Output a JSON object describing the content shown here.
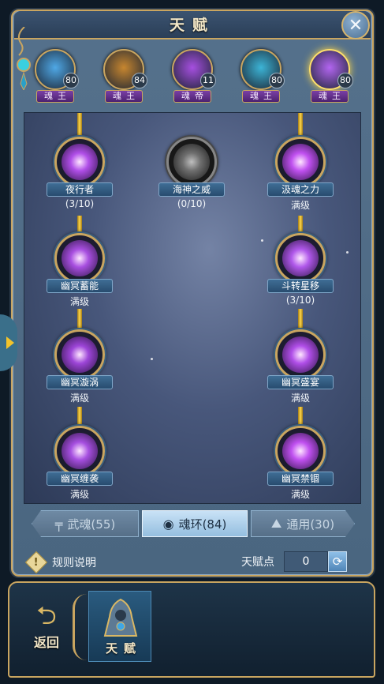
{
  "header": {
    "title": "天赋"
  },
  "spirits": [
    {
      "level": "80",
      "rank": "魂王",
      "color": "#4fa8e6",
      "selected": false
    },
    {
      "level": "84",
      "rank": "魂王",
      "color": "#c7862f",
      "selected": false
    },
    {
      "level": "11",
      "rank": "魂帝",
      "color": "#a64fe0",
      "selected": false
    },
    {
      "level": "80",
      "rank": "魂王",
      "color": "#3cb4d6",
      "selected": false
    },
    {
      "level": "80",
      "rank": "魂王",
      "color": "#b265f0",
      "selected": true
    }
  ],
  "talents": [
    {
      "name": "夜行者",
      "level": "(3/10)",
      "color": "#b04ee8",
      "locked": false
    },
    {
      "name": "海神之威",
      "level": "(0/10)",
      "color": "#8a8a8a",
      "locked": true
    },
    {
      "name": "汲魂之力",
      "level": "满级",
      "color": "#c050f0",
      "locked": false
    },
    {
      "name": "幽冥蓄能",
      "level": "满级",
      "color": "#a84fe0",
      "locked": false
    },
    {
      "name": "斗转星移",
      "level": "(3/10)",
      "color": "#b058ea",
      "locked": false
    },
    {
      "name": "幽冥漩涡",
      "level": "满级",
      "color": "#9d45d8",
      "locked": false
    },
    {
      "name": "幽冥盛宴",
      "level": "满级",
      "color": "#b04ee8",
      "locked": false
    },
    {
      "name": "幽冥缠袭",
      "level": "满级",
      "color": "#a64fe0",
      "locked": false
    },
    {
      "name": "幽冥禁锢",
      "level": "满级",
      "color": "#c050f0",
      "locked": false
    }
  ],
  "tabs": [
    {
      "label": "武魂(55)",
      "icon": "weapon-spirit-icon",
      "active": false
    },
    {
      "label": "魂环(84)",
      "icon": "soul-ring-icon",
      "active": true
    },
    {
      "label": "通用(30)",
      "icon": "meditation-icon",
      "active": false
    }
  ],
  "footer": {
    "help_label": "规则说明",
    "points_label": "天赋点",
    "points_value": "0"
  },
  "bottom_nav": {
    "back_label": "返回",
    "talent_label": "天赋"
  },
  "colors": {
    "gold": "#c9a560",
    "accent_purple": "#b04ee8"
  }
}
